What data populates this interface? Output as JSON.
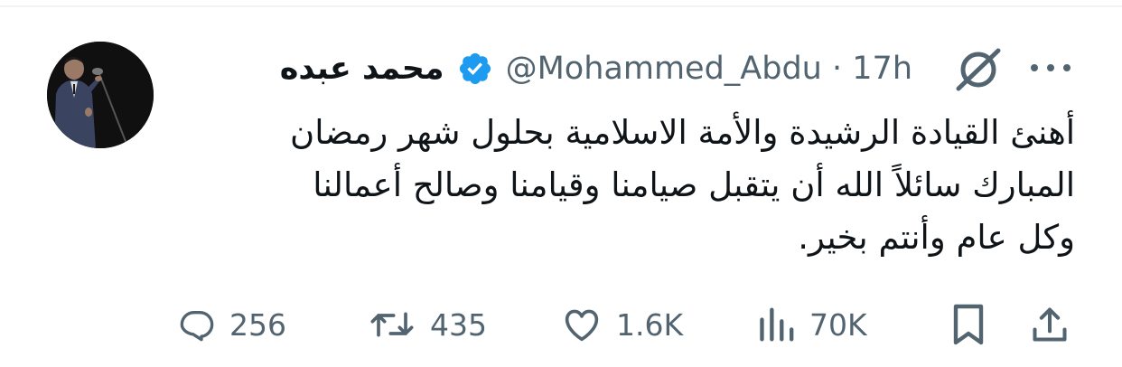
{
  "author": {
    "display_name": "محمد عبده",
    "handle": "@Mohammed_Abdu",
    "time": "17h",
    "separator": "·",
    "verified": true
  },
  "tweet": {
    "lines": [
      "أهنئ القيادة الرشيدة والأمة الاسلامية بحلول شهر رمضان",
      "المبارك سائلاً الله أن يتقبل صيامنا وقيامنا وصالح أعمالنا",
      "وكل عام وأنتم بخير."
    ]
  },
  "actions": {
    "reply": {
      "icon": "reply-icon",
      "count": "256"
    },
    "repost": {
      "icon": "repost-icon",
      "count": "435"
    },
    "like": {
      "icon": "heart-icon",
      "count": "1.6K"
    },
    "views": {
      "icon": "views-icon",
      "count": "70K"
    },
    "bookmark": {
      "icon": "bookmark-icon"
    },
    "share": {
      "icon": "share-icon"
    }
  },
  "colors": {
    "verified_badge": "#1d9bf0",
    "secondary_text": "#536471",
    "primary_text": "#0f1419"
  }
}
